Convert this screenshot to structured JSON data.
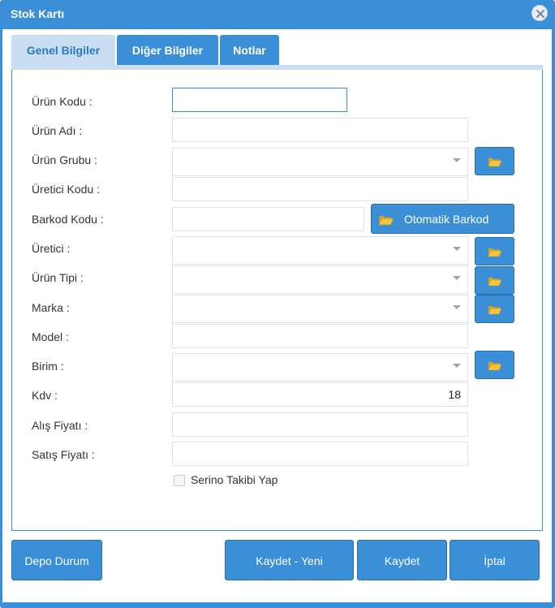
{
  "window": {
    "title": "Stok Kartı"
  },
  "tabs": [
    {
      "label": "Genel Bilgiler",
      "active": true
    },
    {
      "label": "Diğer Bilgiler",
      "active": false
    },
    {
      "label": "Notlar",
      "active": false
    }
  ],
  "form": {
    "urun_kodu": {
      "label": "Ürün Kodu :",
      "value": ""
    },
    "urun_adi": {
      "label": "Ürün Adı :",
      "value": ""
    },
    "urun_grubu": {
      "label": "Ürün Grubu :",
      "value": ""
    },
    "uretici_kodu": {
      "label": "Üretici Kodu :",
      "value": ""
    },
    "barkod_kodu": {
      "label": "Barkod Kodu :",
      "value": ""
    },
    "uretici": {
      "label": "Üretici :",
      "value": ""
    },
    "urun_tipi": {
      "label": "Ürün Tipi :",
      "value": ""
    },
    "marka": {
      "label": "Marka :",
      "value": ""
    },
    "model": {
      "label": "Model :",
      "value": ""
    },
    "birim": {
      "label": "Birim :",
      "value": ""
    },
    "kdv": {
      "label": "Kdv :",
      "value": "18"
    },
    "alis_fiyati": {
      "label": "Alış Fiyatı :",
      "value": ""
    },
    "satis_fiyati": {
      "label": "Satış Fiyatı :",
      "value": ""
    },
    "otomatik_barkod_label": "Otomatik Barkod",
    "serino_label": "Serino Takibi Yap",
    "serino_checked": false
  },
  "footer": {
    "depo_durum": "Depo Durum",
    "kaydet_yeni": "Kaydet - Yeni",
    "kaydet": "Kaydet",
    "iptal": "İptal"
  },
  "colors": {
    "accent": "#3a8fd6",
    "tab_active_bg": "#c9def1",
    "folder_icon": "#f5c542"
  },
  "icons": {
    "close": "close-icon",
    "folder": "folder-open-icon",
    "caret": "chevron-down-icon"
  }
}
